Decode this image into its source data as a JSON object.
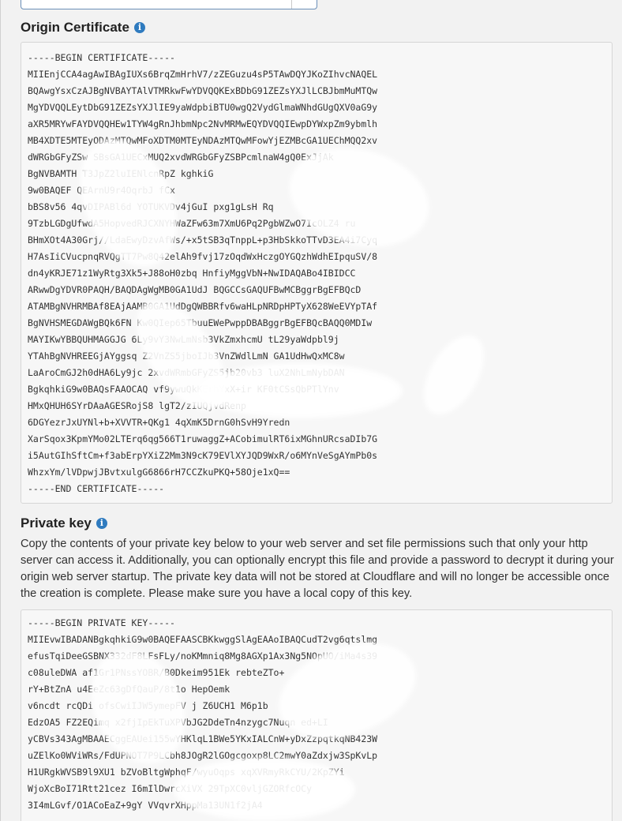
{
  "certificate": {
    "title": "Origin Certificate",
    "text": "-----BEGIN CERTIFICATE-----\nMIIEnjCCA4agAwIBAgIUXs6BrqZmHrhV7/zZEGuzu4sP5TAwDQYJKoZIhvcNAQEL\nBQAwgYsxCzAJBgNVBAYTAlVTMRkwFwYDVQQKExBDbG91ZEZsYXJlLCBJbmMuMTQw\nMgYDVQQLEytDbG91ZEZsYXJlIE9yaWdpbiBTU0wgQ2VydGlmaWNhdGUgQXV0aG9y\naXR5MRYwFAYDVQQHEw1TYW4gRnJhbmNpc2NvMRMwEQYDVQQIEwpDYWxpZm9ybmlh\nMB4XDTE5MTEyODAzMTQwMFoXDTM0MTEyNDAzMTQwMFowYjEZMBcGA1UEChMQQ2xv\ndWRGbGFyZSw SBsGA1UECxMUQ2xvdWRGbGFyZSBPcmlnaW4gQ0ExJjAk\nBgNVBAMTH T3JpZ2luIENlcnRpZ kghkiG\n9w0BAQEF QEArnU9r4OqrbJ fCx\nbBS8v56 4qvDIPABl6d YOTUKVDv4jGuI pxg1gLsH Rq\n9TzbLGDgUfwdA5HopvedRJCXNYHWaZFw63m7XmU6Pq2PgbWZwO7IcOLZ4 ru\nBHmXOt4A30Grj//LdaEwyDzvAfWs/+x5tSB3qTnppL+p3HbSkkoTTvD3EA4i7Cyq\nH7AsIiCVucpnqRVQgTT7Pw8Q42elAh9fvj17zOqdWxHczgOYGQzhWdhEIpquSV/8\ndn4yKRJE71z1WyRtg3Xk5+J88oH0zbq HnfiyMggVbN+NwIDAQABo4IBIDCC\nARwwDgYDVR0PAQH/BAQDAgWgMB0GA1UdJ BQGCCsGAQUFBwMCBggrBgEFBQcD\nATAMBgNVHRMBAf8EAjAAMB0GA1UdDgQWBBRfv6waHLpNRDpHPTyX628WeEVYpTAf\nBgNVHSMEGDAWgBQk6FN Kw0QIep65TbuuEWePwppDBABggrBgEFBQcBAQQ0MDIw\nMAYIKwYBBQUHMAGGJG 6Ly9vY3NwLmNsb3VkZmxhcmU tL29yaWdpbl9j\nYTAhBgNVHREEGjAYggsq Z2VnZS5jboIJb3VnZWdlLmN GA1UdHwQxMC8w\nLaAroCmGJ2h0dHA6Ly9jc 2xvdWRmbGFyZS5jb20vb3 luX2NhLmNybDAN\nBgkqhkiG9w0BAQsFAAOCAQ vf9ywuQkKErhYxX+ir KF0tCSsQbPTlYnv\nHMxQHUH6SYrDAaAGESRojS8 lgT2/zIUQjvdRenp\n6DGYezrJxUYNl+b+XVVTR+QKg1 4qXmK5DrnG0hSvH9Yredn\nXarSqox3KpmYMo02LTErq6qg566T1ruwaggZ+ACobimulRT6ixMGhnURcsaDIb7G\ni5AutGIhSftCm+f3abErpYXiZ2Mm3N9cK79EVlXYJQD9WxR/o6MYnVeSgAYmPb0s\nWhzxYm/lVDpwjJBvtxulgG6866rH7CCZkuPKQ+58Oje1xQ==\n-----END CERTIFICATE-----"
  },
  "private_key": {
    "title": "Private key",
    "description": "Copy the contents of your private key below to your web server and set file permissions such that only your http server can access it. Additionally, you can optionally encrypt this file and provide a password to decrypt it during your origin web server startup. The private key data will not be stored at Cloudflare and will no longer be accessible once the creation is complete. Please make sure you have a local copy of this key.",
    "text": "-----BEGIN PRIVATE KEY-----\nMIIEvwIBADANBgkqhkiG9w0BAQEFAASCBKkwggSlAgEAAoIBAQCudT2vg6qtslmg\nefusTqiDeeGSBNX332dF8LFsFLy/noKMmniq8Mg8AGXp1Ax3Ng5NOpUO/iMa4s39\nc08uleDWA af1Gr1PNssYOBR/B0Dkeim951Ek rebteZTo+\nrY+BtZnA u4EeZc63gDfQauP/8t1o HepOemk\nv6ncdt rcQDi ofsCwiIJW5ymepFV j Z6UCH1 M6p1b\nEdzOA5 FZ2EQimq x2fjIpEkTuXPVbJG2DdeTn4nzygc7Nuqn ed+LI\nyCBVs343AgMBAAECggEAUei155wYHKlqL1BWe5YKxIALCnW+yDxZzpqtkqNB423W\nuZElKo0WViWRs/FdUPNOT7P9LCbh8JOgR2lGOgcgoxp8LC2mwY0aZdxjw3SpKvLp\nH1URgkWVSB9l9XU1 bZVoBltgWphqF/wyuOqps xqXVRmyRkCYU/2KpZYi\nWjoXcBoI71Rtt21cez I6mIlDwrcXiVX 29TpXC0vljGZORfcOCy\n3I4mLGvf/O1ACoEaZ+9gY VVqvrXHppMa13UN1f2jA4"
  },
  "icons": {
    "info": "info-icon",
    "info_glyph": "i"
  },
  "colors": {
    "background": "#f2f2f2",
    "code_background": "#f7f7f7",
    "info_icon": "#2f7bbf",
    "select_border": "#6b8fb8"
  }
}
